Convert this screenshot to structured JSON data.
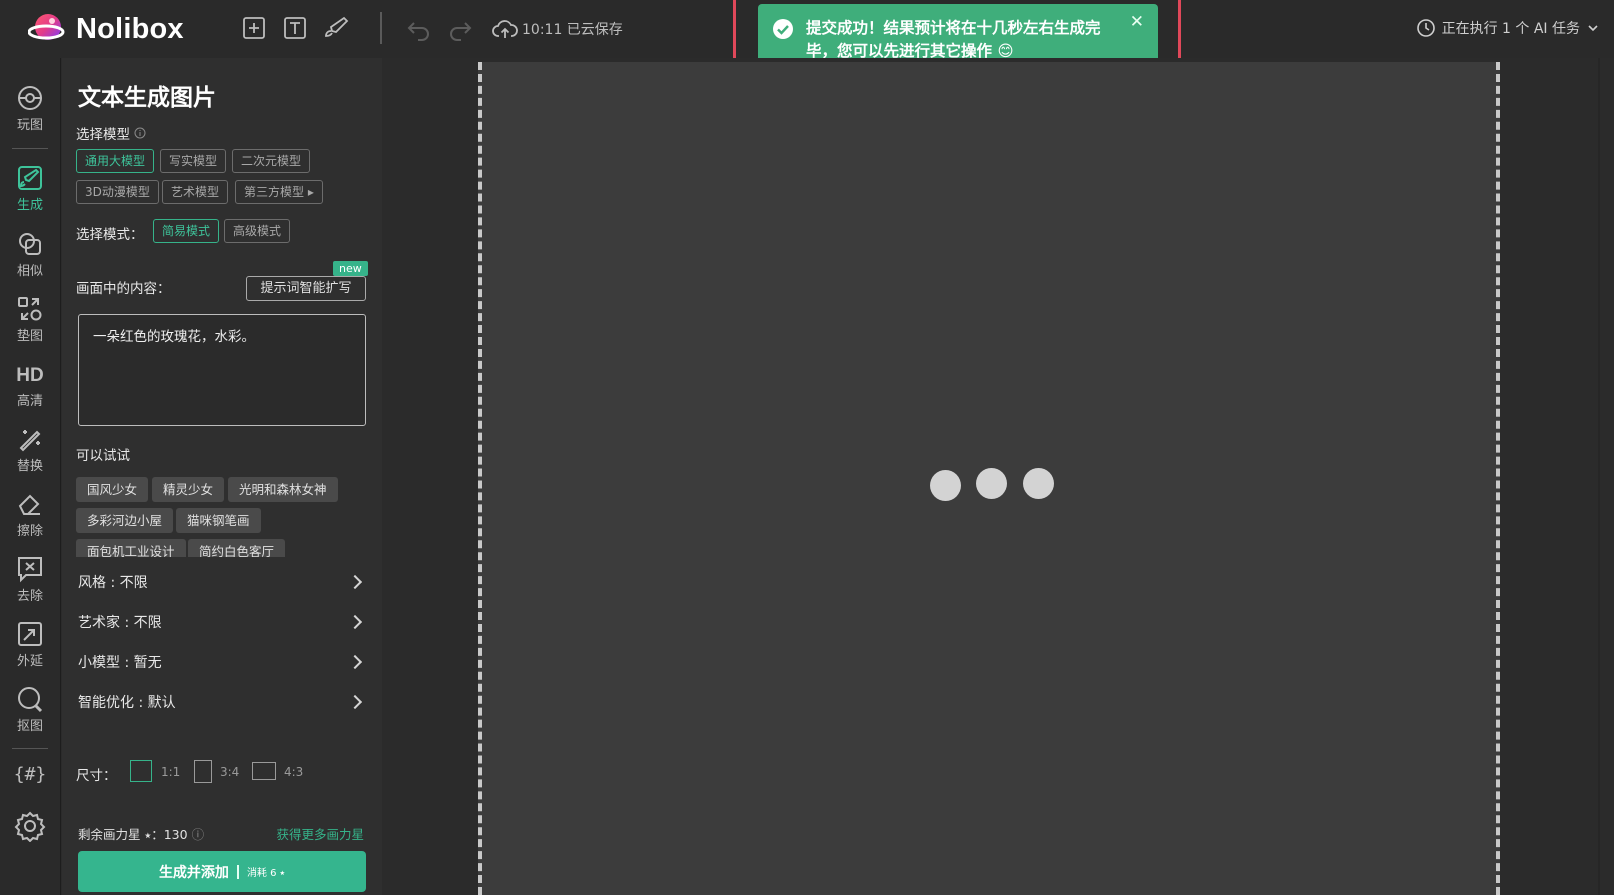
{
  "brand": {
    "name": "Nolibox"
  },
  "topbar": {
    "save_status": "10:11 已云保存",
    "task_status": "正在执行 1 个 AI 任务"
  },
  "toast": {
    "message": "提交成功！结果预计将在十几秒左右生成完毕，您可以先进行其它操作 😊"
  },
  "rail": {
    "items": [
      {
        "label": "玩图",
        "icon": "play-icon"
      },
      {
        "label": "生成",
        "icon": "brush-icon"
      },
      {
        "label": "相似",
        "icon": "copy-icon"
      },
      {
        "label": "垫图",
        "icon": "swap-icon"
      },
      {
        "label": "高清",
        "icon": "hd-icon"
      },
      {
        "label": "替换",
        "icon": "wand-icon"
      },
      {
        "label": "擦除",
        "icon": "eraser-icon"
      },
      {
        "label": "去除",
        "icon": "remove-icon"
      },
      {
        "label": "外延",
        "icon": "expand-icon"
      },
      {
        "label": "抠图",
        "icon": "cutout-icon"
      }
    ],
    "plugin_icon_text": "{#}"
  },
  "panel": {
    "title": "文本生成图片",
    "model_label": "选择模型",
    "models": [
      "通用大模型",
      "写实模型",
      "二次元模型",
      "3D动漫模型",
      "艺术模型",
      "第三方模型 ▸"
    ],
    "active_model": "通用大模型",
    "mode_label": "选择模式：",
    "modes": [
      "简易模式",
      "高级模式"
    ],
    "active_mode": "简易模式",
    "content_label": "画面中的内容：",
    "new_badge": "new",
    "expand_button": "提示词智能扩写",
    "prompt_text": "一朵红色的玫瑰花，水彩。",
    "try_label": "可以试试",
    "suggestions": [
      "国风少女",
      "精灵少女",
      "光明和森林女神",
      "多彩河边小屋",
      "猫咪钢笔画",
      "面包机工业设计",
      "简约白色客厅"
    ],
    "settings": [
      {
        "label": "风格 : 不限"
      },
      {
        "label": "艺术家 : 不限"
      },
      {
        "label": "小模型 : 暂无"
      },
      {
        "label": "智能优化 : 默认"
      }
    ],
    "size_label": "尺寸：",
    "sizes": [
      "1:1",
      "3:4",
      "4:3"
    ],
    "active_size": "1:1",
    "stars_text": "剩余画力星 ⭑：130",
    "more_stars": "获得更多画力星",
    "generate_button": "生成并添加",
    "generate_cost": "消耗 6 ⭑"
  },
  "colors": {
    "accent": "#36b38a",
    "toast": "#3fae7b",
    "highlight": "#e0485a"
  }
}
